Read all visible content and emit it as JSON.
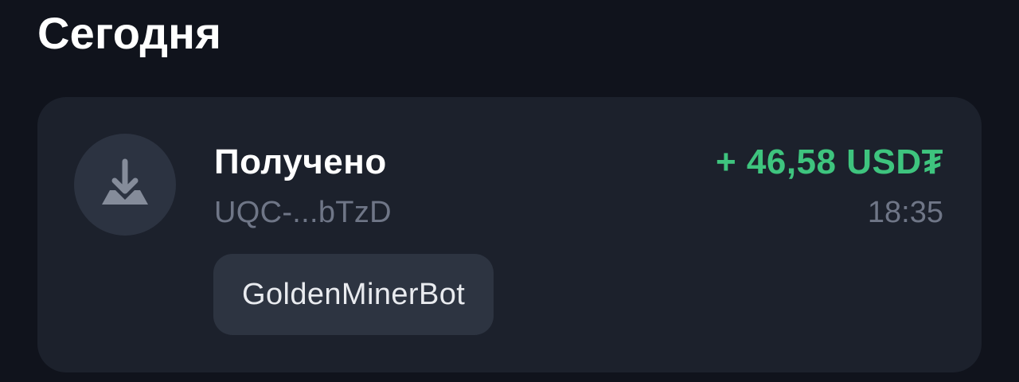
{
  "section": {
    "title": "Сегодня"
  },
  "transaction": {
    "type_label": "Получено",
    "address": "UQC-...bTzD",
    "amount": "+ 46,58 USD₮",
    "time": "18:35",
    "tag": "GoldenMinerBot",
    "icon": "download-arrow-icon",
    "amount_color": "#3ec47e"
  }
}
